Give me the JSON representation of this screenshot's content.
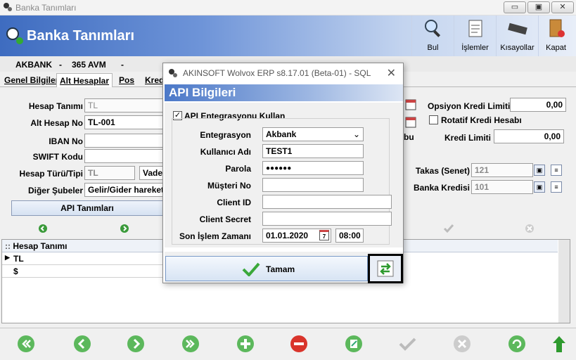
{
  "window": {
    "title": "Banka Tanımları",
    "min": "▭",
    "max": "▣",
    "close": "✕"
  },
  "header": {
    "title": "Banka Tanımları",
    "toolbar": [
      {
        "label": "Bul",
        "icon": "search-icon"
      },
      {
        "label": "İşlemler",
        "icon": "clipboard-icon"
      },
      {
        "label": "Kısayollar",
        "icon": "keyboard-icon"
      },
      {
        "label": "Kapat",
        "icon": "exit-icon"
      }
    ]
  },
  "subbar": {
    "bank": "AKBANK",
    "sep1": "-",
    "branch": "365 AVM",
    "sep2": "-"
  },
  "tabs": [
    "Genel Bilgiler",
    "Alt Hesaplar",
    "Pos",
    "Kredi"
  ],
  "form": {
    "hesap_tanimi_label": "Hesap Tanımı",
    "hesap_tanimi": "TL",
    "alt_hesap_no_label": "Alt Hesap No",
    "alt_hesap_no": "TL-001",
    "iban_label": "IBAN No",
    "iban": "",
    "swift_label": "SWIFT Kodu",
    "swift": "",
    "hesap_turu_label": "Hesap Türü/Tipi",
    "hesap_turu": "TL",
    "hesap_tipi": "Vade",
    "diger_label": "Diğer Şubeler",
    "diger": "Gelir/Gider hareket",
    "api_button": "API Tanımları",
    "opsiyon_label": "Opsiyon Kredi Limiti",
    "opsiyon": "0,00",
    "rotatif_label": "Rotatif Kredi Hesabı",
    "rotatif_checked": false,
    "kredi_limiti_label": "Kredi Limiti",
    "kredi_limiti": "0,00",
    "takas_label": "Takas (Senet)",
    "takas": "121",
    "banka_kredisi_label": "Banka Kredisi",
    "banka_kredisi": "101",
    "partial_label": "bul"
  },
  "grid": {
    "header": "Hesap Tanımı",
    "rows": [
      "TL",
      "$"
    ]
  },
  "dialog": {
    "title": "AKINSOFT Wolvox ERP s8.17.01 (Beta-01) - SQL",
    "heading": "API Bilgileri",
    "enable_label": "API Entegrasyonu Kullan",
    "enable_checked": true,
    "entegrasyon_label": "Entegrasyon",
    "entegrasyon": "Akbank",
    "kullanici_label": "Kullanıcı Adı",
    "kullanici": "TEST1",
    "parola_label": "Parola",
    "parola": "●●●●●●",
    "musteri_label": "Müşteri No",
    "musteri": "",
    "client_id_label": "Client ID",
    "client_id": "",
    "client_secret_label": "Client Secret",
    "client_secret": "",
    "son_islem_label": "Son İşlem Zamanı",
    "son_islem_date": "01.01.2020",
    "son_islem_time": "08:00",
    "calendar_day": "7",
    "ok_label": "Tamam"
  },
  "colors": {
    "header_blue": "#3e6cc0",
    "nav_green": "#3a9a3a",
    "nav_red": "#d02020"
  }
}
